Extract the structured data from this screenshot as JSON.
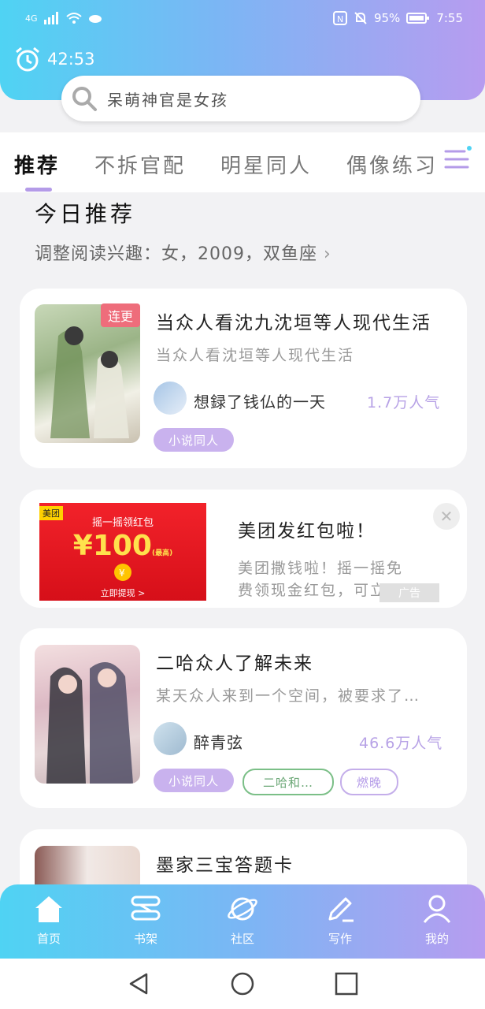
{
  "status_bar": {
    "network": "4G",
    "battery": "95%",
    "time": "7:55"
  },
  "timer": {
    "value": "42:53"
  },
  "search": {
    "placeholder": "呆萌神官是女孩"
  },
  "tabs": [
    {
      "label": "推荐"
    },
    {
      "label": "不拆官配"
    },
    {
      "label": "明星同人"
    },
    {
      "label": "偶像练习"
    }
  ],
  "section": {
    "title": "今日推荐",
    "subtitle": "调整阅读兴趣：女，2009，双鱼座"
  },
  "books": [
    {
      "badge": "连更",
      "title": "当众人看沈九沈垣等人现代生活",
      "desc": "当众人看沈垣等人现代生活",
      "author": "想録了钱仏的一天",
      "popularity": "1.7万人气",
      "tags": [
        "小说同人"
      ]
    },
    {
      "title": "二哈众人了解未来",
      "desc": "某天众人来到一个空间，被要求了…",
      "author": "醉青弦",
      "popularity": "46.6万人气",
      "tags": [
        "小说同人",
        "二哈和…",
        "燃晚"
      ]
    },
    {
      "title": "墨家三宝答题卡"
    }
  ],
  "ad": {
    "brand": "美团",
    "banner_title": "摇一摇领红包",
    "amount": "¥100",
    "amount_note": "(最高)",
    "cta": "立即提现 >",
    "title": "美团发红包啦！",
    "desc_line1": "美团撒钱啦！摇一摇免",
    "desc_line2": "费领现金红包，可立…",
    "label": "广告"
  },
  "bottom_nav": [
    {
      "label": "首页",
      "icon": "home-icon"
    },
    {
      "label": "书架",
      "icon": "bookshelf-icon"
    },
    {
      "label": "社区",
      "icon": "planet-icon"
    },
    {
      "label": "写作",
      "icon": "pen-icon"
    },
    {
      "label": "我的",
      "icon": "user-icon"
    }
  ],
  "colors": {
    "accent": "#b49be8",
    "gradient_start": "#4fd3f3",
    "gradient_end": "#b79cf0",
    "badge": "#ee6d7b"
  }
}
